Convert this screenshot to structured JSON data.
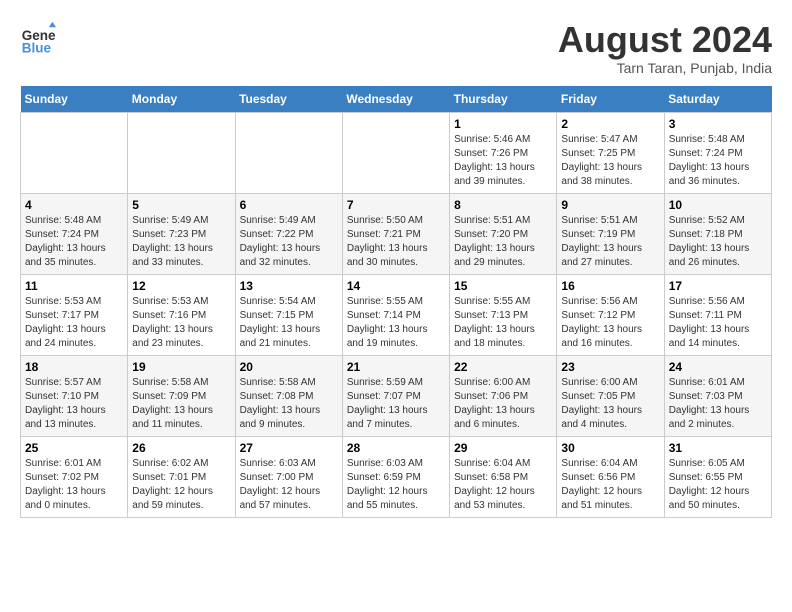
{
  "header": {
    "logo_line1": "General",
    "logo_line2": "Blue",
    "month_year": "August 2024",
    "location": "Tarn Taran, Punjab, India"
  },
  "weekdays": [
    "Sunday",
    "Monday",
    "Tuesday",
    "Wednesday",
    "Thursday",
    "Friday",
    "Saturday"
  ],
  "weeks": [
    [
      {
        "day": "",
        "info": ""
      },
      {
        "day": "",
        "info": ""
      },
      {
        "day": "",
        "info": ""
      },
      {
        "day": "",
        "info": ""
      },
      {
        "day": "1",
        "info": "Sunrise: 5:46 AM\nSunset: 7:26 PM\nDaylight: 13 hours\nand 39 minutes."
      },
      {
        "day": "2",
        "info": "Sunrise: 5:47 AM\nSunset: 7:25 PM\nDaylight: 13 hours\nand 38 minutes."
      },
      {
        "day": "3",
        "info": "Sunrise: 5:48 AM\nSunset: 7:24 PM\nDaylight: 13 hours\nand 36 minutes."
      }
    ],
    [
      {
        "day": "4",
        "info": "Sunrise: 5:48 AM\nSunset: 7:24 PM\nDaylight: 13 hours\nand 35 minutes."
      },
      {
        "day": "5",
        "info": "Sunrise: 5:49 AM\nSunset: 7:23 PM\nDaylight: 13 hours\nand 33 minutes."
      },
      {
        "day": "6",
        "info": "Sunrise: 5:49 AM\nSunset: 7:22 PM\nDaylight: 13 hours\nand 32 minutes."
      },
      {
        "day": "7",
        "info": "Sunrise: 5:50 AM\nSunset: 7:21 PM\nDaylight: 13 hours\nand 30 minutes."
      },
      {
        "day": "8",
        "info": "Sunrise: 5:51 AM\nSunset: 7:20 PM\nDaylight: 13 hours\nand 29 minutes."
      },
      {
        "day": "9",
        "info": "Sunrise: 5:51 AM\nSunset: 7:19 PM\nDaylight: 13 hours\nand 27 minutes."
      },
      {
        "day": "10",
        "info": "Sunrise: 5:52 AM\nSunset: 7:18 PM\nDaylight: 13 hours\nand 26 minutes."
      }
    ],
    [
      {
        "day": "11",
        "info": "Sunrise: 5:53 AM\nSunset: 7:17 PM\nDaylight: 13 hours\nand 24 minutes."
      },
      {
        "day": "12",
        "info": "Sunrise: 5:53 AM\nSunset: 7:16 PM\nDaylight: 13 hours\nand 23 minutes."
      },
      {
        "day": "13",
        "info": "Sunrise: 5:54 AM\nSunset: 7:15 PM\nDaylight: 13 hours\nand 21 minutes."
      },
      {
        "day": "14",
        "info": "Sunrise: 5:55 AM\nSunset: 7:14 PM\nDaylight: 13 hours\nand 19 minutes."
      },
      {
        "day": "15",
        "info": "Sunrise: 5:55 AM\nSunset: 7:13 PM\nDaylight: 13 hours\nand 18 minutes."
      },
      {
        "day": "16",
        "info": "Sunrise: 5:56 AM\nSunset: 7:12 PM\nDaylight: 13 hours\nand 16 minutes."
      },
      {
        "day": "17",
        "info": "Sunrise: 5:56 AM\nSunset: 7:11 PM\nDaylight: 13 hours\nand 14 minutes."
      }
    ],
    [
      {
        "day": "18",
        "info": "Sunrise: 5:57 AM\nSunset: 7:10 PM\nDaylight: 13 hours\nand 13 minutes."
      },
      {
        "day": "19",
        "info": "Sunrise: 5:58 AM\nSunset: 7:09 PM\nDaylight: 13 hours\nand 11 minutes."
      },
      {
        "day": "20",
        "info": "Sunrise: 5:58 AM\nSunset: 7:08 PM\nDaylight: 13 hours\nand 9 minutes."
      },
      {
        "day": "21",
        "info": "Sunrise: 5:59 AM\nSunset: 7:07 PM\nDaylight: 13 hours\nand 7 minutes."
      },
      {
        "day": "22",
        "info": "Sunrise: 6:00 AM\nSunset: 7:06 PM\nDaylight: 13 hours\nand 6 minutes."
      },
      {
        "day": "23",
        "info": "Sunrise: 6:00 AM\nSunset: 7:05 PM\nDaylight: 13 hours\nand 4 minutes."
      },
      {
        "day": "24",
        "info": "Sunrise: 6:01 AM\nSunset: 7:03 PM\nDaylight: 13 hours\nand 2 minutes."
      }
    ],
    [
      {
        "day": "25",
        "info": "Sunrise: 6:01 AM\nSunset: 7:02 PM\nDaylight: 13 hours\nand 0 minutes."
      },
      {
        "day": "26",
        "info": "Sunrise: 6:02 AM\nSunset: 7:01 PM\nDaylight: 12 hours\nand 59 minutes."
      },
      {
        "day": "27",
        "info": "Sunrise: 6:03 AM\nSunset: 7:00 PM\nDaylight: 12 hours\nand 57 minutes."
      },
      {
        "day": "28",
        "info": "Sunrise: 6:03 AM\nSunset: 6:59 PM\nDaylight: 12 hours\nand 55 minutes."
      },
      {
        "day": "29",
        "info": "Sunrise: 6:04 AM\nSunset: 6:58 PM\nDaylight: 12 hours\nand 53 minutes."
      },
      {
        "day": "30",
        "info": "Sunrise: 6:04 AM\nSunset: 6:56 PM\nDaylight: 12 hours\nand 51 minutes."
      },
      {
        "day": "31",
        "info": "Sunrise: 6:05 AM\nSunset: 6:55 PM\nDaylight: 12 hours\nand 50 minutes."
      }
    ]
  ]
}
